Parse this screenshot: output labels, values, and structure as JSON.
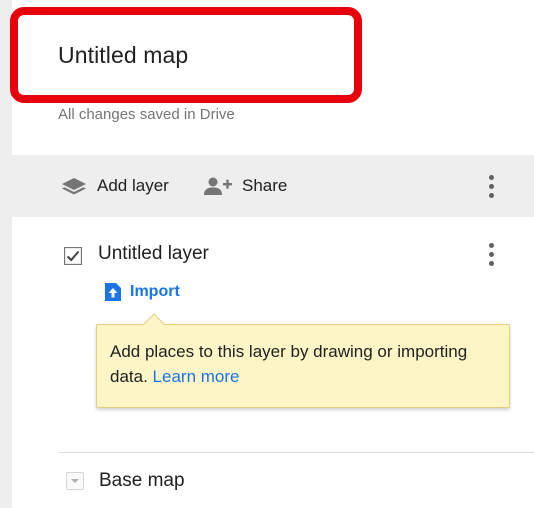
{
  "map": {
    "title": "Untitled map",
    "save_status": "All changes saved in Drive"
  },
  "toolbar": {
    "add_layer_label": "Add layer",
    "share_label": "Share"
  },
  "layer": {
    "name": "Untitled layer",
    "checked": true,
    "import_label": "Import"
  },
  "tooltip": {
    "text": "Add places to this layer by drawing or importing data.",
    "link": "Learn more"
  },
  "basemap": {
    "label": "Base map"
  },
  "colors": {
    "highlight": "#e8000b",
    "link": "#1a73e8",
    "tooltip_bg": "#fdf5c5",
    "toolbar_bg": "#eeeeee"
  },
  "icons": {
    "add_layer": "layers-icon",
    "share": "add-person-icon",
    "import": "upload-icon",
    "more": "more-vert-icon",
    "checkbox": "checkbox-checked-icon",
    "basemap": "chevron-down-icon"
  }
}
